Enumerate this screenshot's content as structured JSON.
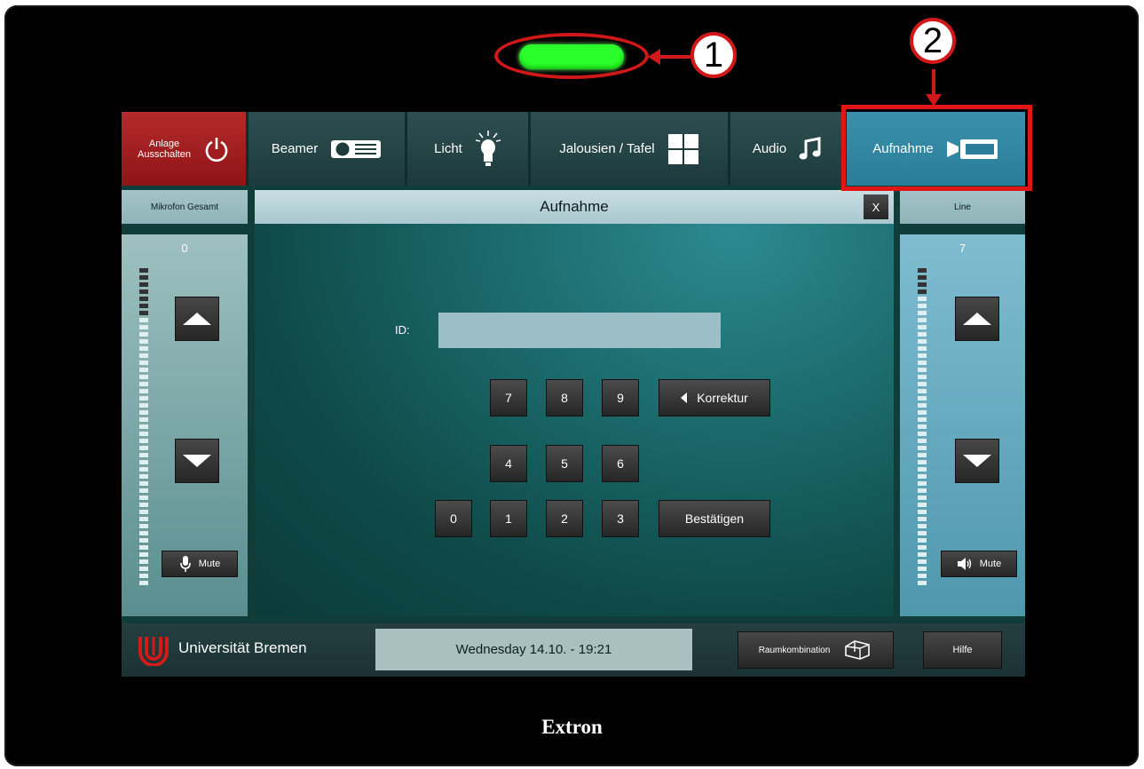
{
  "callouts": [
    "1",
    "2"
  ],
  "nav": {
    "power_label_line1": "Anlage",
    "power_label_line2": "Ausschalten",
    "items": [
      {
        "label": "Beamer",
        "icon": "projector-icon"
      },
      {
        "label": "Licht",
        "icon": "lightbulb-icon"
      },
      {
        "label": "Jalousien / Tafel",
        "icon": "window-blinds-icon"
      },
      {
        "label": "Audio",
        "icon": "music-note-icon"
      },
      {
        "label": "Aufnahme",
        "icon": "video-camera-icon"
      }
    ],
    "active": "Aufnahme"
  },
  "left_panel": {
    "title": "Mikrofon Gesamt",
    "level": "0",
    "mute_label": "Mute"
  },
  "right_panel": {
    "title": "Line",
    "level": "7",
    "mute_label": "Mute"
  },
  "dialog": {
    "title": "Aufnahme",
    "close_label": "X",
    "id_label": "ID:",
    "id_value": "",
    "keypad": [
      "7",
      "8",
      "9",
      "4",
      "5",
      "6",
      "0",
      "1",
      "2",
      "3"
    ],
    "correction_label": "Korrektur",
    "confirm_label": "Bestätigen"
  },
  "footer": {
    "university": "Universität Bremen",
    "datetime": "Wednesday 14.10. - 19:21",
    "room_combination_label": "Raumkombination",
    "help_label": "Hilfe"
  },
  "brand": "Extron",
  "colors": {
    "led": "#2bff2b",
    "highlight": "#e01515",
    "power": "#b62a2c",
    "active_tab": "#3a90aa"
  }
}
